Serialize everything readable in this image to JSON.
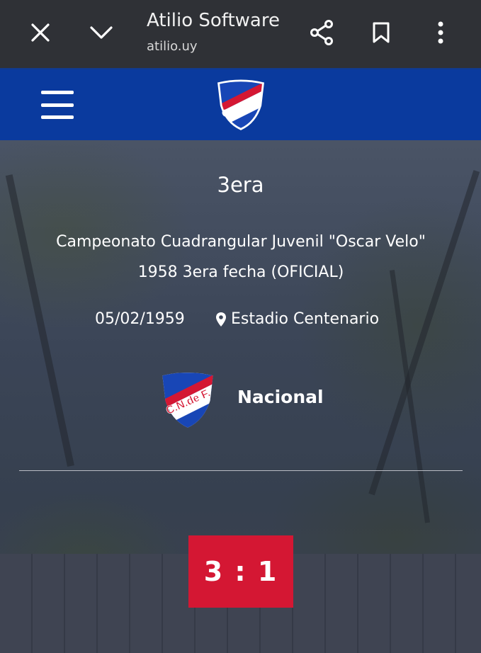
{
  "browser": {
    "title": "Atilio Software",
    "url": "atilio.uy",
    "icons": [
      "close-icon",
      "chevron-down-icon",
      "share-icon",
      "bookmark-icon",
      "more-vert-icon"
    ]
  },
  "site": {
    "header_color": "#0a3a9e",
    "logo_text": "C.N.de F."
  },
  "match": {
    "category": "3era",
    "tournament_line1": "Campeonato Cuadrangular Juvenil \"Oscar Velo\"",
    "tournament_line2": "1958 3era fecha (OFICIAL)",
    "date": "05/02/1959",
    "stadium": "Estadio Centenario",
    "team": "Nacional",
    "score": "3 : 1",
    "score_color": "#d41733"
  }
}
